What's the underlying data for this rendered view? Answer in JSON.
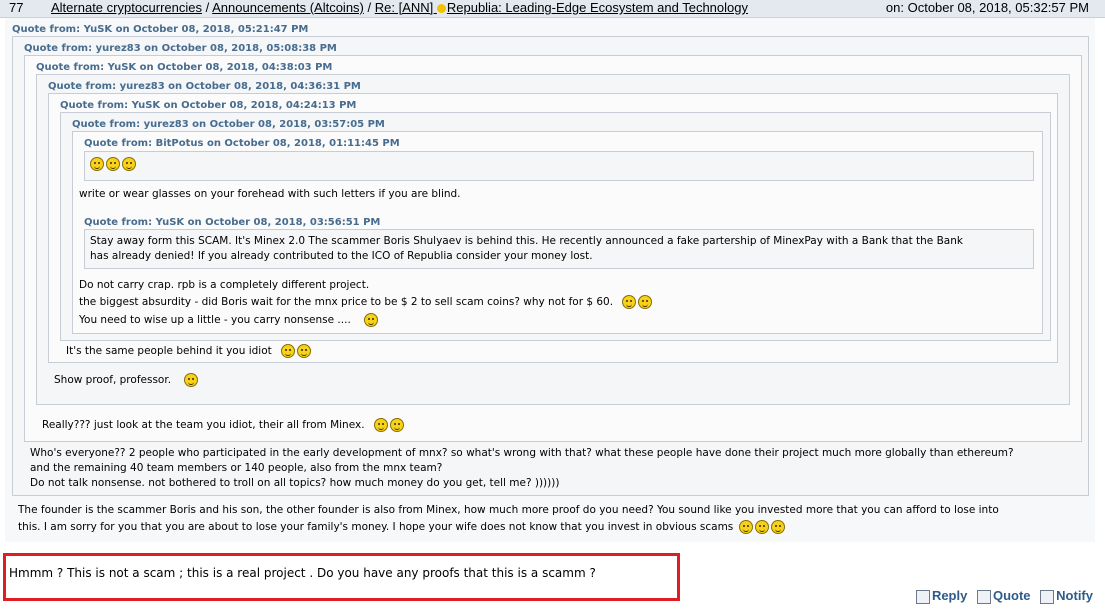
{
  "header": {
    "number": "77",
    "breadcrumb": [
      "Alternate cryptocurrencies",
      "Announcements (Altcoins)",
      "Re: [ANN] ",
      "Republia: Leading-Edge Ecosystem and Technology"
    ],
    "separator": " / ",
    "date": "on: October 08, 2018, 05:32:57 PM"
  },
  "quotes": {
    "q1": "Quote from: YuSK on October 08, 2018, 05:21:47 PM",
    "q2": "Quote from: yurez83 on October 08, 2018, 05:08:38 PM",
    "q3": "Quote from: YuSK on October 08, 2018, 04:38:03 PM",
    "q4": "Quote from: yurez83 on October 08, 2018, 04:36:31 PM",
    "q5": "Quote from: YuSK on October 08, 2018, 04:24:13 PM",
    "q6": "Quote from: yurez83 on October 08, 2018, 03:57:05 PM",
    "q7": "Quote from: BitPotus on October 08, 2018, 01:11:45 PM",
    "q8": "Quote from: YuSK on October 08, 2018, 03:56:51 PM"
  },
  "body": {
    "blind_line": "write or wear glasses on your forehead with such letters if you are blind.",
    "scam_line_1": "Stay away form this SCAM. It's Minex 2.0 The scammer Boris Shulyaev is behind this. He recently announced a fake partership of MinexPay with a Bank that the Bank",
    "scam_line_2": "has already denied! If you already contributed to the ICO of Republia consider your money lost.",
    "crap_1": "Do not carry crap. rpb is a completely different project.",
    "crap_2": "the biggest absurdity - did Boris wait for the mnx price to be $ 2 to sell scam coins? why not for $ 60.",
    "crap_3": " You need to wise up a little - you carry nonsense ....",
    "same_people": "It's the same people behind it you idiot",
    "show_proof": "Show proof, professor.",
    "really": "Really??? just look at the team you idiot, their all from Minex.",
    "everyone_1": "Who's everyone?? 2 people who participated in the early development of mnx? so what's wrong with that? what these people have done their project much more globally than ethereum?",
    "everyone_2": "and the remaining 40 team members or 140 people, also from the mnx team?",
    "everyone_3": "Do not talk nonsense. not bothered to troll on all topics? how much money do you get, tell me?  ))))))",
    "founder_1": "The founder is the scammer Boris and his son, the other founder is also from Minex, how much more proof do you need? You sound like you invested more that you can afford to lose into",
    "founder_2": "this. I am sorry for you that you are about to lose your family's money. I hope your wife does not know that you invest in obvious scams"
  },
  "reply": {
    "message": "Hmmm ? This is not a scam ; this is a real project . Do you have any proofs that this is a scamm ?"
  },
  "actions": {
    "reply": "Reply",
    "quote": "Quote",
    "notify": "Notify"
  },
  "icons": {
    "emoticon": "smiley-icon",
    "star": "star-icon",
    "reply": "reply-icon",
    "quote": "quote-icon",
    "notify": "notify-icon"
  },
  "colors": {
    "quote_header": "#476c8e",
    "highlight_border": "#e01c24",
    "action_link": "#2e5b8a"
  }
}
